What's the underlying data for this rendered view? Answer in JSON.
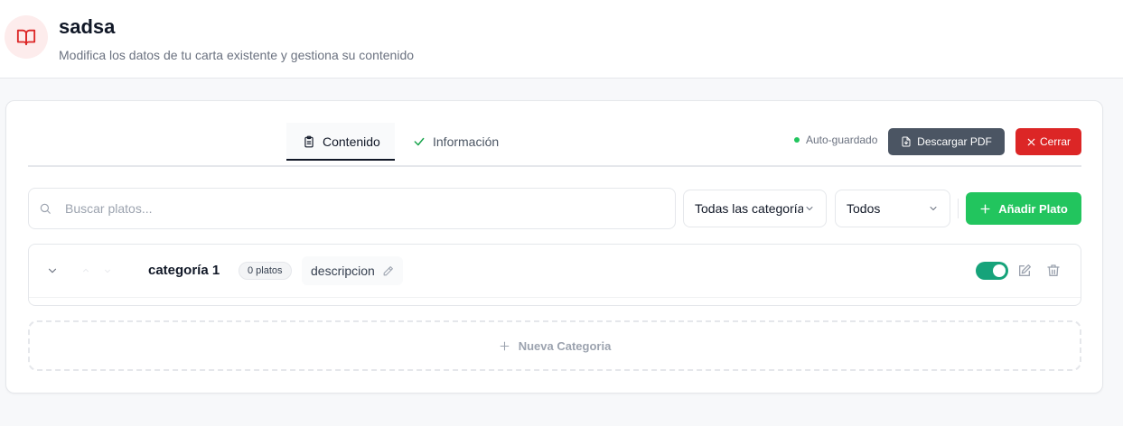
{
  "header": {
    "title": "sadsa",
    "subtitle": "Modifica los datos de tu carta existente y gestiona su contenido",
    "logo_icon": "book-open-icon",
    "logo_color": "#dc2626"
  },
  "tabs": [
    {
      "label": "Contenido",
      "icon": "clipboard-icon",
      "active": true
    },
    {
      "label": "Información",
      "icon": "check-icon",
      "active": false
    }
  ],
  "toolbar": {
    "autosave_label": "Auto-guardado",
    "download_pdf_label": "Descargar PDF",
    "close_label": "Cerrar"
  },
  "filters": {
    "search_placeholder": "Buscar platos...",
    "search_value": "",
    "category_select": "Todas las categorías",
    "status_select": "Todos",
    "add_dish_label": "Añadir Plato"
  },
  "categories": [
    {
      "name": "categoría 1",
      "count_label": "0 platos",
      "description": "descripcion",
      "enabled": true
    }
  ],
  "new_category_label": "Nueva Categoria",
  "colors": {
    "accent_green": "#22c55e",
    "toggle_green": "#16a37a",
    "danger": "#dc2626",
    "slate_button": "#4b5563"
  }
}
